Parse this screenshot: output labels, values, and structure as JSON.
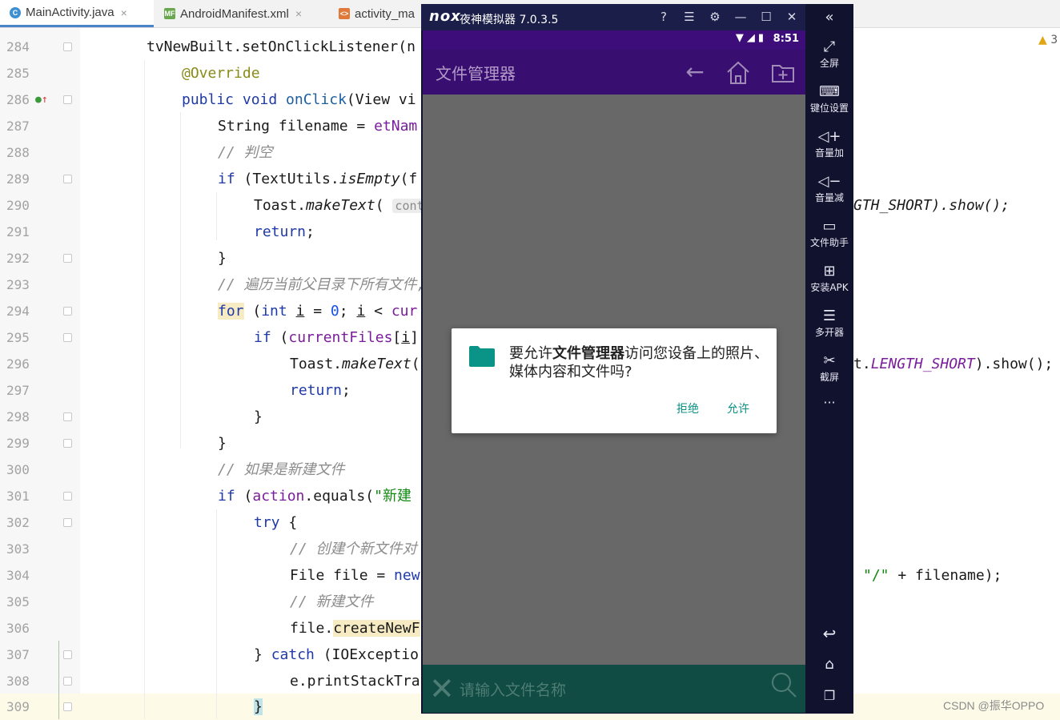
{
  "ide": {
    "tabs": [
      {
        "label": "MainActivity.java",
        "icon": "java-class-icon",
        "active": true
      },
      {
        "label": "AndroidManifest.xml",
        "icon": "manifest-file-icon",
        "active": false
      },
      {
        "label": "activity_ma",
        "icon": "xml-layout-icon",
        "active": false
      }
    ],
    "warning_count": "3",
    "line_numbers": [
      "284",
      "285",
      "286",
      "287",
      "288",
      "289",
      "290",
      "291",
      "292",
      "293",
      "294",
      "295",
      "296",
      "297",
      "298",
      "299",
      "300",
      "301",
      "302",
      "303",
      "304",
      "305",
      "306",
      "307",
      "308",
      "309"
    ],
    "right_fragments": {
      "line290": "GTH_SHORT).show();",
      "line296_a": "t.",
      "line296_b": "LENGTH_SHORT",
      "line296_c": ").show();",
      "line304_a": "\"/\"",
      "line304_b": " + filename);"
    }
  },
  "emulator": {
    "title": "夜神模拟器 7.0.3.5",
    "logo": "nox",
    "status_time": "8:51",
    "app_title": "文件管理器",
    "search_placeholder": "请输入文件名称",
    "dialog": {
      "message_prefix": "要允许",
      "message_app": "文件管理器",
      "message_suffix": "访问您设备上的照片、媒体内容和文件吗?",
      "deny_label": "拒绝",
      "allow_label": "允许"
    },
    "side_tools": [
      {
        "label": "全屏",
        "icon": "fullscreen-icon"
      },
      {
        "label": "键位设置",
        "icon": "keyboard-icon"
      },
      {
        "label": "音量加",
        "icon": "volume-up-icon"
      },
      {
        "label": "音量减",
        "icon": "volume-down-icon"
      },
      {
        "label": "文件助手",
        "icon": "file-assistant-icon"
      },
      {
        "label": "安装APK",
        "icon": "install-apk-icon"
      },
      {
        "label": "多开器",
        "icon": "multi-instance-icon"
      },
      {
        "label": "截屏",
        "icon": "screenshot-icon"
      }
    ],
    "more_label": "···"
  },
  "watermark": "CSDN @振华OPPO"
}
